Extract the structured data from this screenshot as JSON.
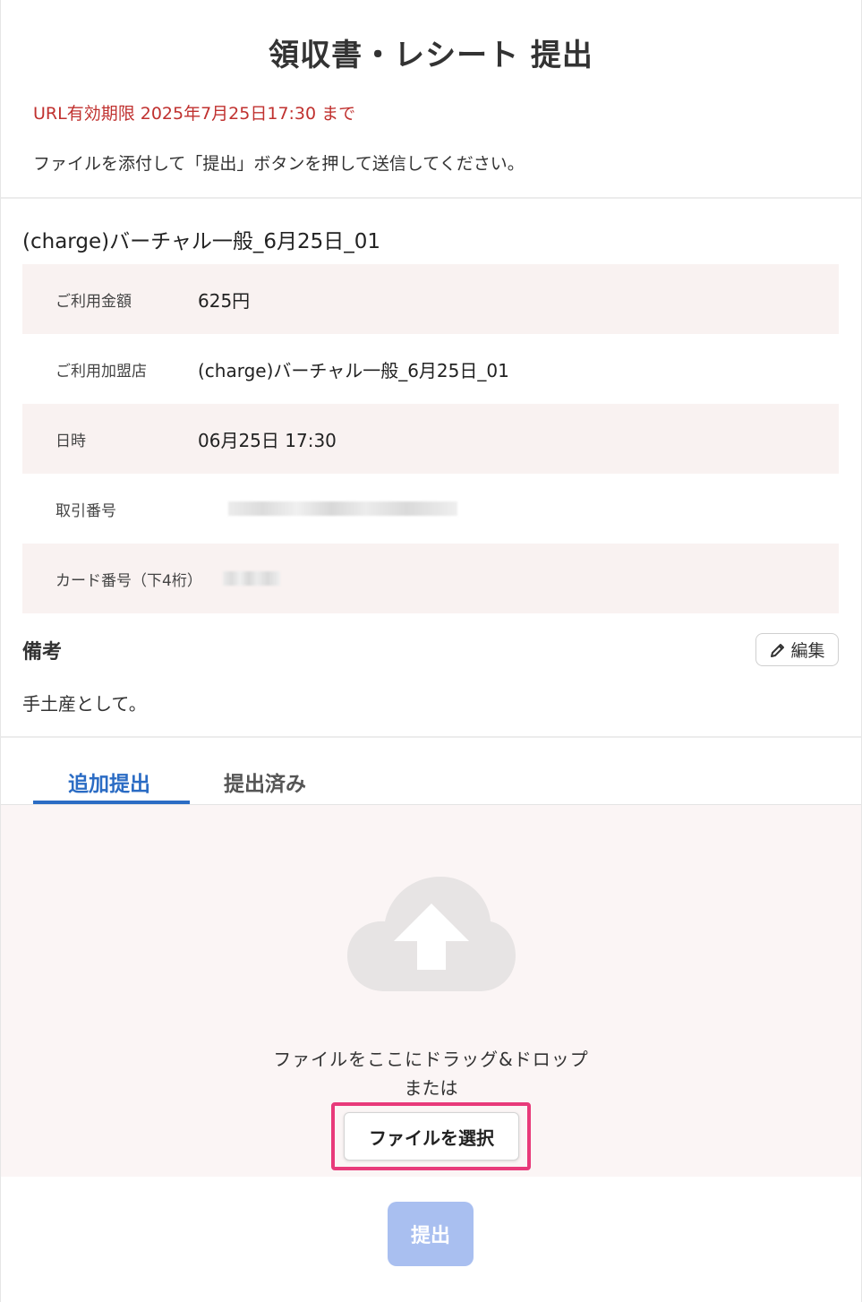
{
  "header": {
    "title": "領収書・レシート 提出",
    "expiry": "URL有効期限 2025年7月25日17:30 まで",
    "instruction": "ファイルを添付して「提出」ボタンを押して送信してください。"
  },
  "transaction": {
    "title": "(charge)バーチャル一般_6月25日_01",
    "rows": [
      {
        "label": "ご利用金額",
        "value": "625円"
      },
      {
        "label": "ご利用加盟店",
        "value": "(charge)バーチャル一般_6月25日_01"
      },
      {
        "label": "日時",
        "value": "06月25日 17:30"
      },
      {
        "label": "取引番号",
        "value": ""
      },
      {
        "label": "カード番号（下4桁）",
        "value": ""
      }
    ]
  },
  "remarks": {
    "heading": "備考",
    "edit_label": "編集",
    "text": "手土産として。"
  },
  "tabs": {
    "add": "追加提出",
    "submitted": "提出済み"
  },
  "dropzone": {
    "drop_text": "ファイルをここにドラッグ&ドロップ",
    "or_text": "または",
    "select_label": "ファイルを選択",
    "icon": "cloud-upload-icon"
  },
  "submit": {
    "label": "提出"
  },
  "colors": {
    "accent_blue": "#2b6cc4",
    "expiry_red": "#c0312f",
    "highlight_pink": "#e83a7a",
    "submit_disabled": "#a9bff0"
  }
}
